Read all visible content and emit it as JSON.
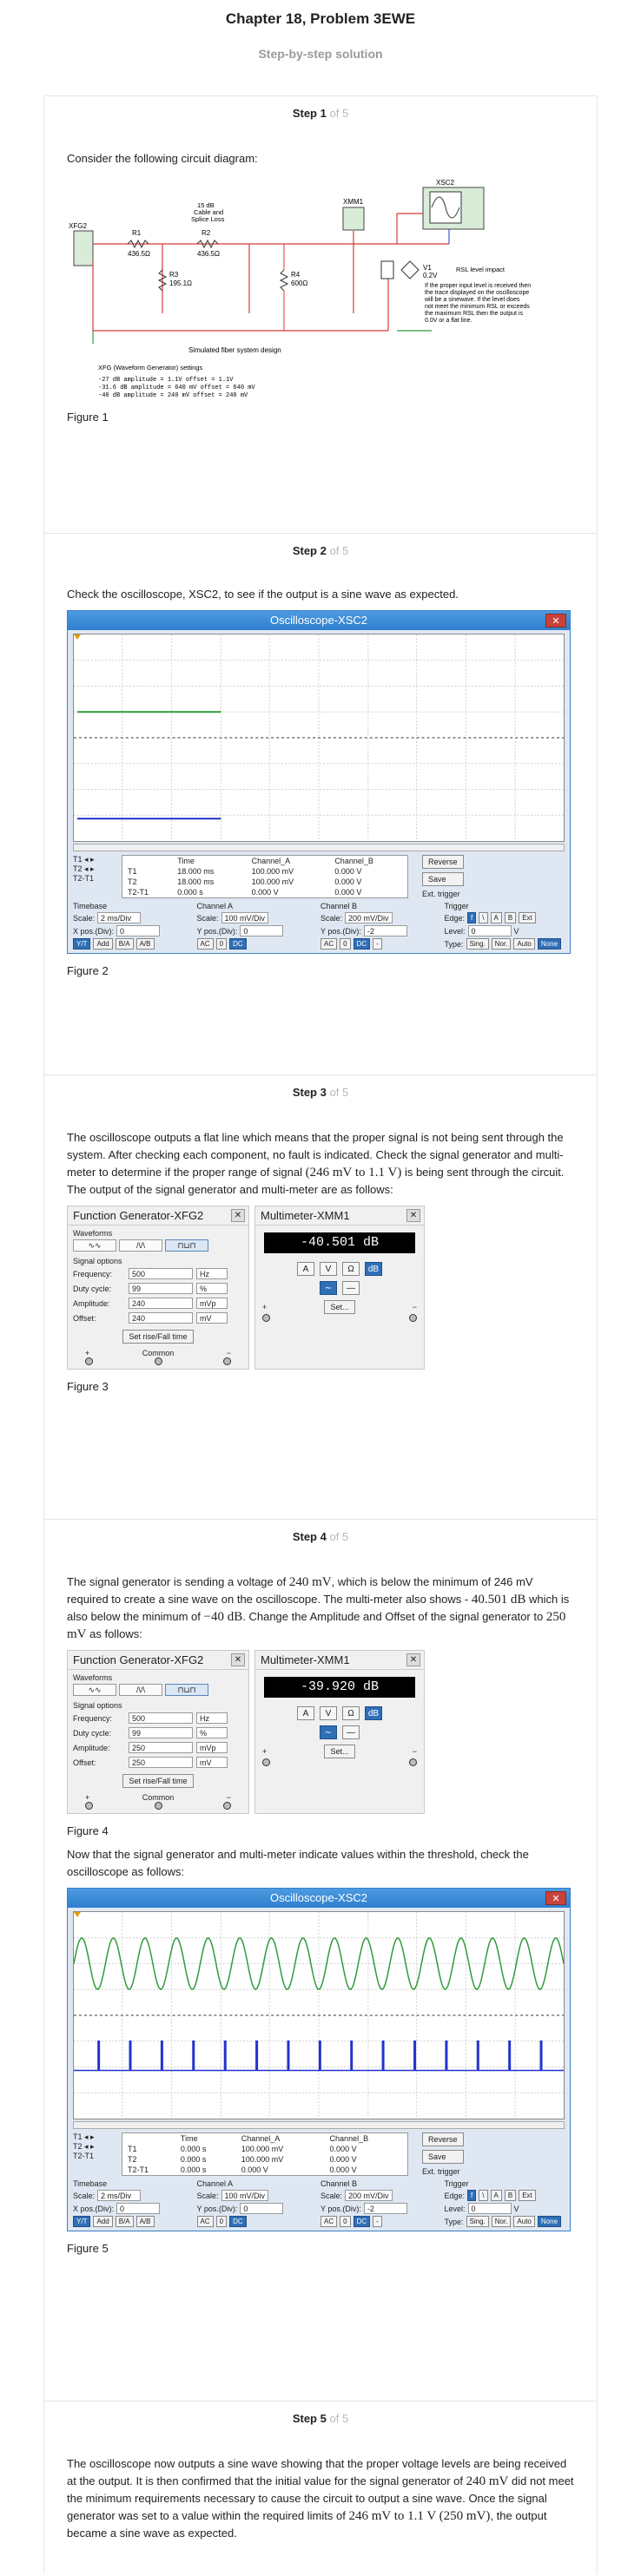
{
  "header": {
    "title": "Chapter 18, Problem 3EWE",
    "subtitle": "Step-by-step solution"
  },
  "step_word": "Step",
  "step_total": "of 5",
  "step1": {
    "num": "1",
    "text": "Consider the following circuit diagram:",
    "figure": "Figure 1",
    "circuit": {
      "xfg": "XFG2",
      "xsc": "XSC2",
      "xmm": "XMM1",
      "cable_label": "15 dB",
      "cable_label2": "Cable and",
      "cable_label3": "Splice Loss",
      "r1": "R1",
      "r1v": "436.5Ω",
      "r2": "R2",
      "r2v": "436.5Ω",
      "r3": "R3",
      "r3v": "195.1Ω",
      "r4": "R4",
      "r4v": "600Ω",
      "v1": "V1",
      "v1v": "0.2V",
      "rsl": "RSL level impact",
      "note1": "If the proper input level is received then",
      "note2": "the trace displayed on the oscilloscope",
      "note3": "will be a sinewave.  If the level does",
      "note4": "not meet the minimum RSL or exceeds",
      "note5": "the maximum RSL then the output is",
      "note6": "0.0V or a flat line.",
      "design": "Simulated fiber system design",
      "settings_title": "XFG (Waveform Generator) settings",
      "settings": [
        "-27 dB    amplitude = 1.1V       offset = 1.1V",
        "-31.6 dB  amplitude = 640 mV     offset = 640 mV",
        "-40 dB    amplitude = 240 mV     offset = 240 mV"
      ]
    }
  },
  "step2": {
    "num": "2",
    "text": "Check the oscilloscope, XSC2, to see if the output is a sine wave as expected.",
    "figure": "Figure 2"
  },
  "scope": {
    "title": "Oscilloscope-XSC2",
    "cols": [
      "",
      "Time",
      "Channel_A",
      "Channel_B"
    ],
    "readings_fig2": [
      [
        "T1",
        "18.000 ms",
        "100.000 mV",
        "0.000 V"
      ],
      [
        "T2",
        "18.000 ms",
        "100.000 mV",
        "0.000 V"
      ],
      [
        "T2-T1",
        "0.000 s",
        "0.000 V",
        "0.000 V"
      ]
    ],
    "readings_fig5": [
      [
        "T1",
        "0.000 s",
        "100.000 mV",
        "0.000 V"
      ],
      [
        "T2",
        "0.000 s",
        "100.000 mV",
        "0.000 V"
      ],
      [
        "T2-T1",
        "0.000 s",
        "0.000 V",
        "0.000 V"
      ]
    ],
    "reverse": "Reverse",
    "save": "Save",
    "ext_trigger": "Ext. trigger",
    "timebase": "Timebase",
    "scale_lbl": "Scale:",
    "timebase_scale": "2 ms/Div",
    "xpos_lbl": "X pos.(Div):",
    "xpos": "0",
    "chA": "Channel A",
    "chA_scale": "100 mV/Div",
    "ypos_lbl": "Y pos.(Div):",
    "chA_ypos": "0",
    "chB": "Channel B",
    "chB_scale": "200 mV/Div",
    "chB_ypos": "-2",
    "trigger": "Trigger",
    "edge_lbl": "Edge:",
    "level_lbl": "Level:",
    "level": "0",
    "level_unit": "V",
    "edge_btns": [
      "f",
      "\\",
      "A",
      "B",
      "Ext"
    ],
    "mode_btns": [
      "Y/T",
      "Add",
      "B/A",
      "A/B"
    ],
    "coupling": [
      "AC",
      "0",
      "DC"
    ],
    "coupling_b": [
      "AC",
      "0",
      "DC",
      "-"
    ],
    "type_lbl": "Type:",
    "type_btns": [
      "Sing.",
      "Nor.",
      "Auto",
      "None"
    ]
  },
  "step3": {
    "num": "3",
    "text_a": "The oscilloscope outputs a flat line which means that the proper signal is not being sent through the system. After checking each component, no fault is indicated. Check the signal generator and multi-meter to determine if the proper range of signal",
    "math1": "(246 mV to 1.1 V)",
    "text_b": "is being sent through the circuit. The output of the signal generator and multi-meter are as follows:",
    "figure": "Figure 3",
    "fg": {
      "amplitude": "240",
      "offset": "240"
    },
    "mm_value": "-40.501 dB"
  },
  "fg": {
    "title": "Function Generator-XFG2",
    "waveforms": "Waveforms",
    "signal_options": "Signal options",
    "freq_lbl": "Frequency:",
    "freq": "500",
    "freq_unit": "Hz",
    "duty_lbl": "Duty cycle:",
    "duty": "99",
    "duty_unit": "%",
    "amp_lbl": "Amplitude:",
    "amp_unit": "mVp",
    "off_lbl": "Offset:",
    "off_unit": "mV",
    "rise_btn": "Set rise/Fall time",
    "plus": "+",
    "common": "Common",
    "minus": "−"
  },
  "mm": {
    "title": "Multimeter-XMM1",
    "btns": [
      "A",
      "V",
      "Ω",
      "dB"
    ],
    "set_btn": "Set...",
    "plus": "+",
    "minus": "−"
  },
  "step4": {
    "num": "4",
    "t1": "The signal generator is sending a voltage of",
    "m1": "240 mV",
    "t2": ", which is below the minimum of 246 mV required to create a sine wave on the oscilloscope. The multi-meter also shows -",
    "m2": "40.501 dB",
    "t3": "which is also below the minimum of",
    "m3": "−40 dB",
    "t4": ". Change the Amplitude and Offset of the signal generator to",
    "m4": "250 mV",
    "t5": "as follows:",
    "figure": "Figure 4",
    "fg": {
      "amplitude": "250",
      "offset": "250"
    },
    "mm_value": "-39.920 dB",
    "text2": "Now that the signal generator and multi-meter indicate values within the threshold, check the oscilloscope as follows:",
    "figure2": "Figure 5"
  },
  "step5": {
    "num": "5",
    "t1": "The oscilloscope now outputs a sine wave showing that the proper voltage levels are being received at the output. It is then confirmed that the initial value for the signal generator of",
    "m1": "240 mV",
    "t2": "did not meet the minimum requirements necessary to cause the circuit to output a sine wave. Once the signal generator was set to a value within the required limits of",
    "m2": "246 mV to 1.1 V (250 mV)",
    "t3": ", the output became a sine wave as expected."
  },
  "colors": {
    "channel_a": "#2e9b3a",
    "channel_b": "#2233cc",
    "window_blue": "#3b7fc4",
    "circuit_red": "#d83a3a"
  }
}
